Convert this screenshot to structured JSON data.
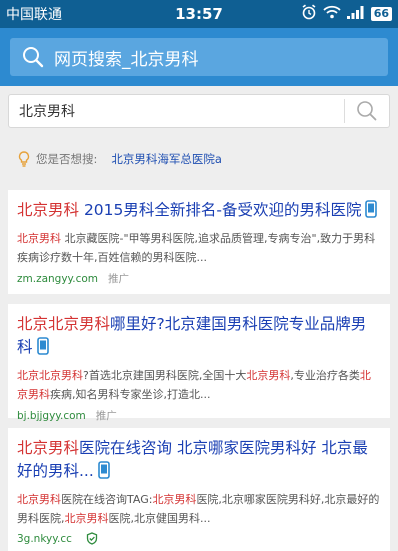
{
  "status": {
    "carrier": "中国联通",
    "time": "13:57",
    "battery": "66"
  },
  "header": {
    "search_label": "网页搜索_北京男科"
  },
  "search": {
    "query": "北京男科"
  },
  "suggestion": {
    "prompt": "您是否想搜:",
    "link": "北京男科海军总医院a"
  },
  "results": [
    {
      "title": [
        {
          "t": "北京男科",
          "hl": true
        },
        {
          "t": " 2015男科全新排名-备受欢迎的男科医院",
          "hl": false
        }
      ],
      "snippet": [
        {
          "t": "北京男科",
          "hl": true
        },
        {
          "t": " 北京藏医院-\"甲等男科医院,追求品质管理,专病专治\",致力于男科疾病诊疗数十年,百姓信赖的男科医院...",
          "hl": false
        }
      ],
      "url": "zm.zangyy.com",
      "promo": "推广"
    },
    {
      "title": [
        {
          "t": "北京北京男科",
          "hl": true
        },
        {
          "t": "哪里好?北京建国男科医院专业品牌男科",
          "hl": false
        }
      ],
      "snippet": [
        {
          "t": "北京北京男科",
          "hl": true
        },
        {
          "t": "?首选北京建国男科医院,全国十大",
          "hl": false
        },
        {
          "t": "北京男科",
          "hl": true
        },
        {
          "t": ",专业治疗各类",
          "hl": false
        },
        {
          "t": "北京男科",
          "hl": true
        },
        {
          "t": "疾病,知名男科专家坐诊,打造北...",
          "hl": false
        }
      ],
      "url": "bj.bjjgyy.com",
      "promo": "推广"
    },
    {
      "title": [
        {
          "t": "北京男科",
          "hl": true
        },
        {
          "t": "医院在线咨询 北京哪家医院男科好 北京最好的男科...",
          "hl": false
        }
      ],
      "snippet": [
        {
          "t": "北京男科",
          "hl": true
        },
        {
          "t": "医院在线咨询TAG:",
          "hl": false
        },
        {
          "t": "北京男科",
          "hl": true
        },
        {
          "t": "医院,北京哪家医院男科好,北京最好的男科医院,",
          "hl": false
        },
        {
          "t": "北京男科",
          "hl": true
        },
        {
          "t": "医院,北京健国男科...",
          "hl": false
        }
      ],
      "url": "3g.nkyy.cc",
      "promo": ""
    }
  ],
  "colors": {
    "status_bg": "#0f5f93",
    "header_bg": "#2d8ad0",
    "highlight": "#d43333",
    "link": "#1a3fb3",
    "url": "#2e8b3d"
  },
  "icons": [
    "alarm-icon",
    "wifi-icon",
    "signal-icon",
    "battery-icon",
    "search-icon",
    "lightbulb-icon",
    "phone-icon",
    "verified-icon"
  ]
}
